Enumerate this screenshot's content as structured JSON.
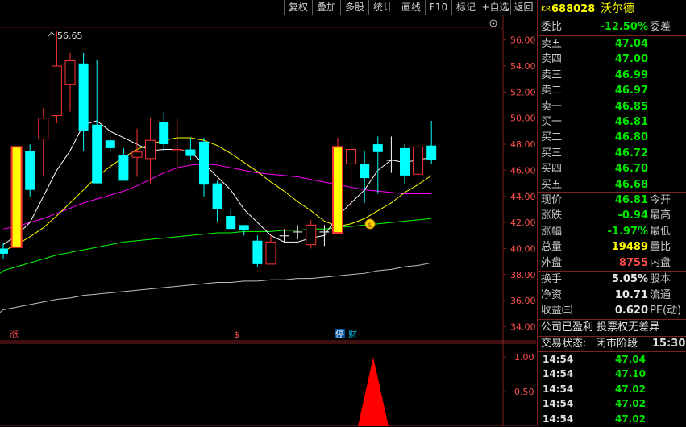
{
  "toolbar": {
    "buttons": [
      "复权",
      "叠加",
      "多股",
      "统计",
      "画线",
      "F10",
      "标记",
      "+自选",
      "返回"
    ]
  },
  "price_axis": {
    "labels": [
      "56.00",
      "54.00",
      "52.00",
      "50.00",
      "48.00",
      "46.00",
      "44.00",
      "42.00",
      "40.00",
      "38.00",
      "36.00",
      "34.00"
    ]
  },
  "volume_axis": {
    "labels": [
      "1.00",
      "0.50"
    ]
  },
  "annotations": {
    "high_label": "56.65",
    "markers": [
      "涨",
      "$",
      "停",
      "财"
    ]
  },
  "quote": {
    "market_tag": "KR",
    "code": "688028",
    "name": "沃尔德",
    "weibi_label": "委比",
    "weibi_value": "-12.50%",
    "weicha_label": "委差",
    "asks": [
      {
        "label": "卖五",
        "price": "47.04"
      },
      {
        "label": "卖四",
        "price": "47.00"
      },
      {
        "label": "卖三",
        "price": "46.99"
      },
      {
        "label": "卖二",
        "price": "46.97"
      },
      {
        "label": "卖一",
        "price": "46.85"
      }
    ],
    "bids": [
      {
        "label": "买一",
        "price": "46.81"
      },
      {
        "label": "买二",
        "price": "46.80"
      },
      {
        "label": "买三",
        "price": "46.72"
      },
      {
        "label": "买四",
        "price": "46.70"
      },
      {
        "label": "买五",
        "price": "46.68"
      }
    ],
    "stats": [
      {
        "label": "现价",
        "value": "46.81",
        "right": "今开",
        "color": "green"
      },
      {
        "label": "涨跌",
        "value": "-0.94",
        "right": "最高",
        "color": "green"
      },
      {
        "label": "涨幅",
        "value": "-1.97%",
        "right": "最低",
        "color": "green"
      },
      {
        "label": "总量",
        "value": "19489",
        "right": "量比",
        "color": "yellow"
      },
      {
        "label": "外盘",
        "value": "8755",
        "right": "内盘",
        "color": "red"
      }
    ],
    "stats2": [
      {
        "label": "换手",
        "value": "5.05%",
        "right": "股本"
      },
      {
        "label": "净资",
        "value": "10.71",
        "right": "流通"
      },
      {
        "label": "收益㈢",
        "value": "0.620",
        "right": "PE(动)"
      }
    ],
    "notice": "公司已盈利 投票权无差异",
    "status_label": "交易状态:",
    "status_value": "闭市阶段",
    "status_time": "15:30:",
    "trades": [
      {
        "time": "14:54",
        "price": "47.04"
      },
      {
        "time": "14:54",
        "price": "47.10"
      },
      {
        "time": "14:54",
        "price": "47.02"
      },
      {
        "time": "14:54",
        "price": "47.02"
      },
      {
        "time": "14:54",
        "price": "47.02"
      }
    ]
  },
  "colors": {
    "up": "#ff3232",
    "down": "#00ffff",
    "limit_up": "#ffff00",
    "ma5": "#ffffff",
    "ma10": "#ffff00",
    "ma20": "#ff00ff",
    "ma60": "#00ff00",
    "ma120": "#c0c0c0",
    "border": "#802020"
  },
  "chart_data": {
    "type": "candlestick",
    "y_range": [
      34,
      57
    ],
    "candles": [
      {
        "o": 40.0,
        "c": 39.6,
        "h": 40.4,
        "l": 39.2
      },
      {
        "o": 40.1,
        "c": 47.8,
        "h": 47.8,
        "l": 40.1,
        "limit": true
      },
      {
        "o": 47.5,
        "c": 44.5,
        "h": 48.0,
        "l": 44.0
      },
      {
        "o": 48.4,
        "c": 50.0,
        "h": 50.8,
        "l": 45.5
      },
      {
        "o": 50.2,
        "c": 54.0,
        "h": 56.65,
        "l": 49.6
      },
      {
        "o": 52.6,
        "c": 54.4,
        "h": 55.0,
        "l": 50.5
      },
      {
        "o": 54.2,
        "c": 49.0,
        "h": 55.0,
        "l": 47.5
      },
      {
        "o": 49.5,
        "c": 45.0,
        "h": 54.5,
        "l": 45.0
      },
      {
        "o": 48.3,
        "c": 47.7,
        "h": 48.5,
        "l": 47.5
      },
      {
        "o": 47.2,
        "c": 45.2,
        "h": 47.7,
        "l": 45.2
      },
      {
        "o": 47.0,
        "c": 47.4,
        "h": 49.2,
        "l": 45.5
      },
      {
        "o": 46.9,
        "c": 48.3,
        "h": 50.0,
        "l": 45.0
      },
      {
        "o": 49.7,
        "c": 48.0,
        "h": 50.5,
        "l": 47.5
      },
      {
        "o": 47.5,
        "c": 47.6,
        "h": 50.0,
        "l": 46.0
      },
      {
        "o": 47.6,
        "c": 47.1,
        "h": 48.5,
        "l": 46.8
      },
      {
        "o": 48.2,
        "c": 44.9,
        "h": 48.5,
        "l": 44.0
      },
      {
        "o": 45.0,
        "c": 43.0,
        "h": 45.2,
        "l": 42.0
      },
      {
        "o": 42.5,
        "c": 41.5,
        "h": 43.0,
        "l": 41.5
      },
      {
        "o": 41.8,
        "c": 41.4,
        "h": 41.8,
        "l": 41.0
      },
      {
        "o": 40.6,
        "c": 38.8,
        "h": 41.0,
        "l": 38.6
      },
      {
        "o": 38.8,
        "c": 40.5,
        "h": 41.0,
        "l": 38.8
      },
      {
        "o": 41.0,
        "c": 41.0,
        "h": 41.5,
        "l": 40.5
      },
      {
        "o": 41.3,
        "c": 41.3,
        "h": 41.8,
        "l": 40.7
      },
      {
        "o": 40.3,
        "c": 41.8,
        "h": 42.2,
        "l": 40.0
      },
      {
        "o": 41.3,
        "c": 41.3,
        "h": 41.8,
        "l": 40.2
      },
      {
        "o": 41.2,
        "c": 47.8,
        "h": 48.5,
        "l": 41.2,
        "limit": true
      },
      {
        "o": 46.5,
        "c": 47.6,
        "h": 48.5,
        "l": 43.0
      },
      {
        "o": 46.5,
        "c": 45.4,
        "h": 47.5,
        "l": 43.5
      },
      {
        "o": 48.0,
        "c": 47.4,
        "h": 48.6,
        "l": 44.2
      },
      {
        "o": 46.8,
        "c": 46.8,
        "h": 48.6,
        "l": 45.8
      },
      {
        "o": 47.7,
        "c": 45.6,
        "h": 48.0,
        "l": 45.0
      },
      {
        "o": 45.7,
        "c": 47.8,
        "h": 48.2,
        "l": 45.5
      },
      {
        "o": 47.9,
        "c": 46.8,
        "h": 49.8,
        "l": 46.5
      }
    ],
    "ma5": [
      40.3,
      41.0,
      42.0,
      44.0,
      46.0,
      47.5,
      49.5,
      49.8,
      49.0,
      48.5,
      48.0,
      47.5,
      47.6,
      47.6,
      47.4,
      46.5,
      45.5,
      44.5,
      43.0,
      42.0,
      41.0,
      40.5,
      40.5,
      40.8,
      41.0,
      42.5,
      43.5,
      44.5,
      46.0,
      46.8,
      46.6,
      46.8,
      47.0
    ],
    "ma10": [
      39.8,
      40.3,
      40.9,
      41.6,
      42.5,
      43.5,
      44.5,
      45.5,
      46.3,
      47.0,
      47.6,
      48.0,
      48.3,
      48.5,
      48.5,
      48.3,
      47.9,
      47.3,
      46.6,
      45.9,
      45.1,
      44.4,
      43.6,
      42.9,
      42.1,
      41.7,
      41.9,
      42.3,
      42.9,
      43.5,
      44.3,
      44.9,
      45.6
    ],
    "ma20": [
      41.5,
      41.7,
      42.0,
      42.3,
      42.7,
      43.1,
      43.5,
      43.8,
      44.1,
      44.4,
      44.8,
      45.3,
      45.8,
      46.2,
      46.4,
      46.5,
      46.4,
      46.2,
      46.0,
      45.8,
      45.7,
      45.6,
      45.5,
      45.3,
      45.1,
      44.9,
      44.7,
      44.5,
      44.4,
      44.3,
      44.2,
      44.2,
      44.2
    ],
    "ma60": [
      38.3,
      38.6,
      38.9,
      39.2,
      39.5,
      39.7,
      39.9,
      40.1,
      40.3,
      40.5,
      40.6,
      40.7,
      40.8,
      40.9,
      41.0,
      41.1,
      41.2,
      41.2,
      41.3,
      41.3,
      41.3,
      41.4,
      41.4,
      41.5,
      41.5,
      41.6,
      41.7,
      41.8,
      41.9,
      42.0,
      42.1,
      42.2,
      42.3
    ],
    "ma120": [
      35.3,
      35.5,
      35.7,
      35.9,
      36.1,
      36.2,
      36.4,
      36.5,
      36.6,
      36.7,
      36.8,
      36.9,
      37.0,
      37.1,
      37.2,
      37.3,
      37.4,
      37.4,
      37.5,
      37.5,
      37.6,
      37.6,
      37.7,
      37.7,
      37.8,
      37.9,
      38.0,
      38.1,
      38.3,
      38.4,
      38.6,
      38.7,
      38.9
    ],
    "indicator": {
      "y_range": [
        0,
        1.2
      ],
      "ticks": [
        1.0,
        0.5
      ],
      "spike_index": 25,
      "spike_value": 1.0
    }
  }
}
